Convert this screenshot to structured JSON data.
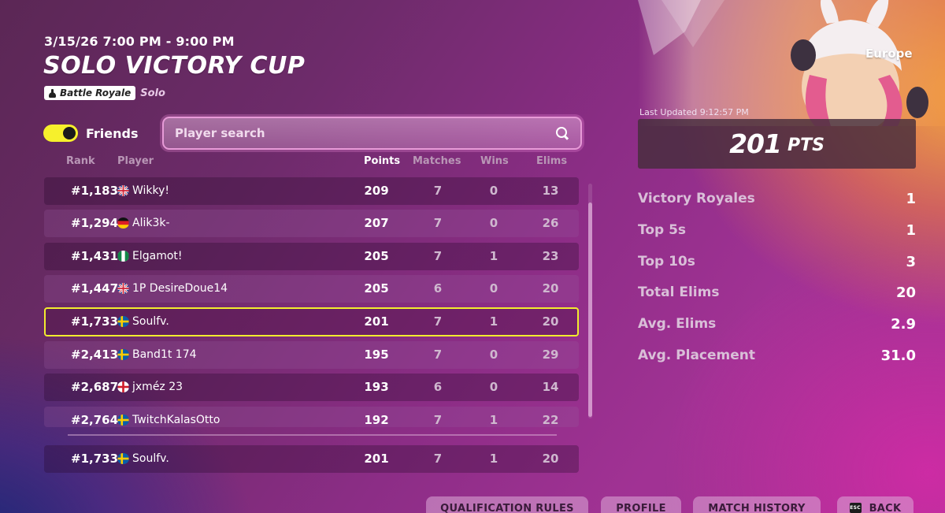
{
  "event": {
    "date_range": "3/15/26 7:00 PM - 9:00 PM",
    "title": "SOLO VICTORY CUP",
    "mode": "Battle Royale",
    "mode_sub": "Solo"
  },
  "filters": {
    "friends_label": "Friends",
    "friends_on": true,
    "search_placeholder": "Player search",
    "search_value": ""
  },
  "columns": {
    "rank": "Rank",
    "player": "Player",
    "points": "Points",
    "matches": "Matches",
    "wins": "Wins",
    "elims": "Elims"
  },
  "rows": [
    {
      "rank": "#1,183",
      "flag": "uk-flag-icon",
      "player": "Wikky!",
      "points": "209",
      "matches": "7",
      "wins": "0",
      "elims": "13"
    },
    {
      "rank": "#1,294",
      "flag": "germany-flag-icon",
      "player": "Alik3k-",
      "points": "207",
      "matches": "7",
      "wins": "0",
      "elims": "26"
    },
    {
      "rank": "#1,431",
      "flag": "nigeria-flag-icon",
      "player": "Elgamot!",
      "points": "205",
      "matches": "7",
      "wins": "1",
      "elims": "23"
    },
    {
      "rank": "#1,447",
      "flag": "uk-flag-icon",
      "player": "1P DesireDoue14",
      "points": "205",
      "matches": "6",
      "wins": "0",
      "elims": "20"
    },
    {
      "rank": "#1,733",
      "flag": "sweden-flag-icon",
      "player": "Soulfv.",
      "points": "201",
      "matches": "7",
      "wins": "1",
      "elims": "20"
    },
    {
      "rank": "#2,413",
      "flag": "sweden-flag-icon",
      "player": "Band1t 174",
      "points": "195",
      "matches": "7",
      "wins": "0",
      "elims": "29"
    },
    {
      "rank": "#2,687",
      "flag": "england-flag-icon",
      "player": "jxméz 23",
      "points": "193",
      "matches": "6",
      "wins": "0",
      "elims": "14"
    },
    {
      "rank": "#2,764",
      "flag": "sweden-flag-icon",
      "player": "TwitchKalasOtto",
      "points": "192",
      "matches": "7",
      "wins": "1",
      "elims": "22"
    }
  ],
  "my_row": {
    "rank": "#1,733",
    "flag": "sweden-flag-icon",
    "player": "Soulfv.",
    "points": "201",
    "matches": "7",
    "wins": "1",
    "elims": "20"
  },
  "panel": {
    "region": "Europe",
    "last_updated": "Last Updated 9:12:57 PM",
    "points_value": "201",
    "points_unit": "PTS",
    "stats": [
      {
        "label": "Victory Royales",
        "value": "1"
      },
      {
        "label": "Top 5s",
        "value": "1"
      },
      {
        "label": "Top 10s",
        "value": "3"
      },
      {
        "label": "Total Elims",
        "value": "20"
      },
      {
        "label": "Avg. Elims",
        "value": "2.9"
      },
      {
        "label": "Avg. Placement",
        "value": "31.0"
      }
    ]
  },
  "buttons": {
    "qualification_rules": "QUALIFICATION RULES",
    "profile": "PROFILE",
    "match_history": "MATCH HISTORY",
    "esc_key": "ESC",
    "back": "BACK"
  },
  "colors": {
    "highlight": "#f2ec2e",
    "toggle_on": "#f6f02c"
  }
}
